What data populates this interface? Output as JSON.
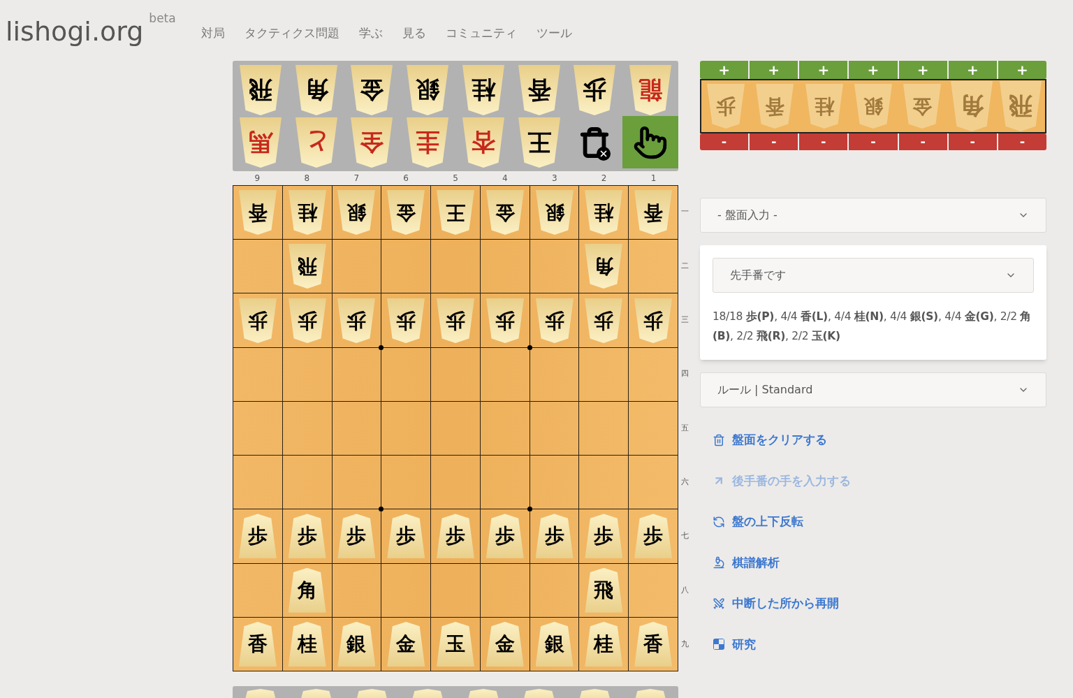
{
  "header": {
    "logo": "lishogi.org",
    "badge": "beta",
    "nav": [
      "対局",
      "タクティクス問題",
      "学ぶ",
      "見る",
      "コミュニティ",
      "ツール"
    ]
  },
  "palette_top": [
    {
      "kind": "piece",
      "piece": "飛",
      "upside_down": true,
      "promoted": false,
      "selected": false
    },
    {
      "kind": "piece",
      "piece": "角",
      "upside_down": true,
      "promoted": false,
      "selected": false
    },
    {
      "kind": "piece",
      "piece": "金",
      "upside_down": true,
      "promoted": false,
      "selected": false
    },
    {
      "kind": "piece",
      "piece": "銀",
      "upside_down": true,
      "promoted": false,
      "selected": false
    },
    {
      "kind": "piece",
      "piece": "桂",
      "upside_down": true,
      "promoted": false,
      "selected": false
    },
    {
      "kind": "piece",
      "piece": "香",
      "upside_down": true,
      "promoted": false,
      "selected": false
    },
    {
      "kind": "piece",
      "piece": "歩",
      "upside_down": true,
      "promoted": false,
      "selected": false
    },
    {
      "kind": "piece",
      "piece": "龍",
      "upside_down": true,
      "promoted": true,
      "selected": false
    },
    {
      "kind": "piece",
      "piece": "馬",
      "upside_down": true,
      "promoted": true,
      "selected": false
    },
    {
      "kind": "piece",
      "piece": "と",
      "upside_down": true,
      "promoted": true,
      "selected": false
    },
    {
      "kind": "piece",
      "piece": "全",
      "upside_down": true,
      "promoted": true,
      "selected": false
    },
    {
      "kind": "piece",
      "piece": "圭",
      "upside_down": true,
      "promoted": true,
      "selected": false
    },
    {
      "kind": "piece",
      "piece": "杏",
      "upside_down": true,
      "promoted": true,
      "selected": false
    },
    {
      "kind": "piece",
      "piece": "王",
      "upside_down": true,
      "promoted": false,
      "selected": false
    },
    {
      "kind": "trash",
      "selected": false
    },
    {
      "kind": "pointer",
      "selected": true
    }
  ],
  "board": {
    "files": [
      "9",
      "8",
      "7",
      "6",
      "5",
      "4",
      "3",
      "2",
      "1"
    ],
    "ranks": [
      "一",
      "二",
      "三",
      "四",
      "五",
      "六",
      "七",
      "八",
      "九"
    ],
    "rows": [
      [
        {
          "kind": "piece",
          "piece": "香",
          "upside_down": true
        },
        {
          "kind": "piece",
          "piece": "桂",
          "upside_down": true
        },
        {
          "kind": "piece",
          "piece": "銀",
          "upside_down": true
        },
        {
          "kind": "piece",
          "piece": "金",
          "upside_down": true
        },
        {
          "kind": "piece",
          "piece": "王",
          "upside_down": true
        },
        {
          "kind": "piece",
          "piece": "金",
          "upside_down": true
        },
        {
          "kind": "piece",
          "piece": "銀",
          "upside_down": true
        },
        {
          "kind": "piece",
          "piece": "桂",
          "upside_down": true
        },
        {
          "kind": "piece",
          "piece": "香",
          "upside_down": true
        }
      ],
      [
        {
          "kind": "empty"
        },
        {
          "kind": "piece",
          "piece": "飛",
          "upside_down": true
        },
        {
          "kind": "empty"
        },
        {
          "kind": "empty"
        },
        {
          "kind": "empty"
        },
        {
          "kind": "empty"
        },
        {
          "kind": "empty"
        },
        {
          "kind": "piece",
          "piece": "角",
          "upside_down": true
        },
        {
          "kind": "empty"
        }
      ],
      [
        {
          "kind": "piece",
          "piece": "歩",
          "upside_down": true
        },
        {
          "kind": "piece",
          "piece": "歩",
          "upside_down": true
        },
        {
          "kind": "piece",
          "piece": "歩",
          "upside_down": true
        },
        {
          "kind": "piece",
          "piece": "歩",
          "upside_down": true
        },
        {
          "kind": "piece",
          "piece": "歩",
          "upside_down": true
        },
        {
          "kind": "piece",
          "piece": "歩",
          "upside_down": true
        },
        {
          "kind": "piece",
          "piece": "歩",
          "upside_down": true
        },
        {
          "kind": "piece",
          "piece": "歩",
          "upside_down": true
        },
        {
          "kind": "piece",
          "piece": "歩",
          "upside_down": true
        }
      ],
      [
        {
          "kind": "empty"
        },
        {
          "kind": "empty"
        },
        {
          "kind": "empty"
        },
        {
          "kind": "empty"
        },
        {
          "kind": "empty"
        },
        {
          "kind": "empty"
        },
        {
          "kind": "empty"
        },
        {
          "kind": "empty"
        },
        {
          "kind": "empty"
        }
      ],
      [
        {
          "kind": "empty"
        },
        {
          "kind": "empty"
        },
        {
          "kind": "empty"
        },
        {
          "kind": "empty"
        },
        {
          "kind": "empty"
        },
        {
          "kind": "empty"
        },
        {
          "kind": "empty"
        },
        {
          "kind": "empty"
        },
        {
          "kind": "empty"
        }
      ],
      [
        {
          "kind": "empty"
        },
        {
          "kind": "empty"
        },
        {
          "kind": "empty"
        },
        {
          "kind": "empty"
        },
        {
          "kind": "empty"
        },
        {
          "kind": "empty"
        },
        {
          "kind": "empty"
        },
        {
          "kind": "empty"
        },
        {
          "kind": "empty"
        }
      ],
      [
        {
          "kind": "piece",
          "piece": "歩",
          "upside_down": false
        },
        {
          "kind": "piece",
          "piece": "歩",
          "upside_down": false
        },
        {
          "kind": "piece",
          "piece": "歩",
          "upside_down": false
        },
        {
          "kind": "piece",
          "piece": "歩",
          "upside_down": false
        },
        {
          "kind": "piece",
          "piece": "歩",
          "upside_down": false
        },
        {
          "kind": "piece",
          "piece": "歩",
          "upside_down": false
        },
        {
          "kind": "piece",
          "piece": "歩",
          "upside_down": false
        },
        {
          "kind": "piece",
          "piece": "歩",
          "upside_down": false
        },
        {
          "kind": "piece",
          "piece": "歩",
          "upside_down": false
        }
      ],
      [
        {
          "kind": "empty"
        },
        {
          "kind": "piece",
          "piece": "角",
          "upside_down": false
        },
        {
          "kind": "empty"
        },
        {
          "kind": "empty"
        },
        {
          "kind": "empty"
        },
        {
          "kind": "empty"
        },
        {
          "kind": "empty"
        },
        {
          "kind": "piece",
          "piece": "飛",
          "upside_down": false
        },
        {
          "kind": "empty"
        }
      ],
      [
        {
          "kind": "piece",
          "piece": "香",
          "upside_down": false
        },
        {
          "kind": "piece",
          "piece": "桂",
          "upside_down": false
        },
        {
          "kind": "piece",
          "piece": "銀",
          "upside_down": false
        },
        {
          "kind": "piece",
          "piece": "金",
          "upside_down": false
        },
        {
          "kind": "piece",
          "piece": "玉",
          "upside_down": false
        },
        {
          "kind": "piece",
          "piece": "金",
          "upside_down": false
        },
        {
          "kind": "piece",
          "piece": "銀",
          "upside_down": false
        },
        {
          "kind": "piece",
          "piece": "桂",
          "upside_down": false
        },
        {
          "kind": "piece",
          "piece": "香",
          "upside_down": false
        }
      ]
    ]
  },
  "hand": {
    "plus": "+",
    "minus": "-",
    "pieces": [
      {
        "piece": "歩",
        "empty": true
      },
      {
        "piece": "香",
        "empty": true
      },
      {
        "piece": "桂",
        "empty": true
      },
      {
        "piece": "銀",
        "empty": true
      },
      {
        "piece": "金",
        "empty": true
      },
      {
        "piece": "角",
        "empty": true
      },
      {
        "piece": "飛",
        "empty": true
      }
    ]
  },
  "position_select": "- 盤面入力 -",
  "turn_select": "先手番です",
  "piece_count": "18/18 **歩(P)**, 4/4 **香(L)**, 4/4 **桂(N)**, 4/4 **銀(S)**, 4/4 **金(G)**, 2/2 **角(B)**, 2/2 **飛(R)**, 2/2 **玉(K)**",
  "rules_select": "ルール | Standard",
  "actions": [
    {
      "kind": "trash",
      "label": "盤面をクリアする",
      "disabled": false
    },
    {
      "kind": "arrow",
      "label": "後手番の手を入力する",
      "disabled": true
    },
    {
      "kind": "flip",
      "label": "盤の上下反転",
      "disabled": false
    },
    {
      "kind": "microscope",
      "label": "棋譜解析",
      "disabled": false
    },
    {
      "kind": "swords",
      "label": "中断した所から再開",
      "disabled": false
    },
    {
      "kind": "study",
      "label": "研究",
      "disabled": false
    }
  ]
}
